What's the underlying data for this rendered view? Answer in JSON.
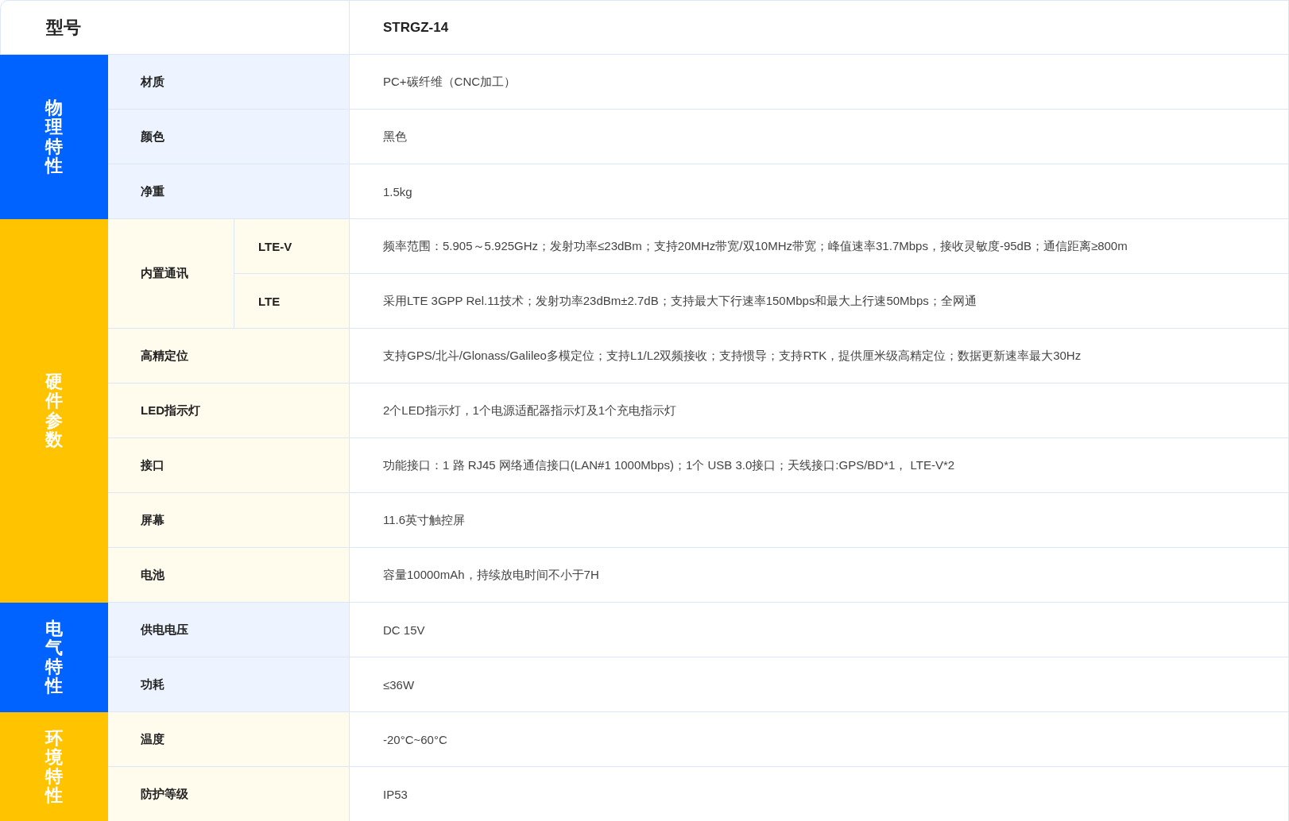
{
  "model": {
    "label": "型号",
    "value": "STRGZ-14"
  },
  "groups": [
    {
      "name": "物理特性",
      "color": "#0062ff",
      "rows": [
        {
          "label": "材质",
          "value": "PC+碳纤维（CNC加工）"
        },
        {
          "label": "颜色",
          "value": "黑色"
        },
        {
          "label": "净重",
          "value": "1.5kg"
        }
      ]
    },
    {
      "name": "硬件参数",
      "color": "#ffc300",
      "rows": [
        {
          "label": "内置通讯",
          "children": [
            {
              "label": "LTE-V",
              "value": "频率范围：5.905～5.925GHz；发射功率≤23dBm；支持20MHz带宽/双10MHz带宽；峰值速率31.7Mbps，接收灵敏度-95dB；通信距离≥800m"
            },
            {
              "label": "LTE",
              "value": "采用LTE 3GPP Rel.11技术；发射功率23dBm±2.7dB；支持最大下行速率150Mbps和最大上行速50Mbps；全网通"
            }
          ]
        },
        {
          "label": "高精定位",
          "value": "支持GPS/北斗/Glonass/Galileo多模定位；支持L1/L2双频接收；支持惯导；支持RTK，提供厘米级高精定位；数据更新速率最大30Hz"
        },
        {
          "label": "LED指示灯",
          "value": "2个LED指示灯，1个电源适配器指示灯及1个充电指示灯"
        },
        {
          "label": "接口",
          "value": "功能接口：1 路 RJ45 网络通信接口(LAN#1 1000Mbps)；1个 USB 3.0接口；天线接口:GPS/BD*1， LTE-V*2"
        },
        {
          "label": "屏幕",
          "value": "11.6英寸触控屏"
        },
        {
          "label": "电池",
          "value": "容量10000mAh，持续放电时间不小于7H"
        }
      ]
    },
    {
      "name": "电气特性",
      "color": "#0062ff",
      "rows": [
        {
          "label": "供电电压",
          "value": "DC 15V"
        },
        {
          "label": "功耗",
          "value": "≤36W"
        }
      ]
    },
    {
      "name": "环境特性",
      "color": "#ffc300",
      "rows": [
        {
          "label": "温度",
          "value": "-20°C~60°C"
        },
        {
          "label": "防护等级",
          "value": "IP53"
        }
      ]
    }
  ]
}
